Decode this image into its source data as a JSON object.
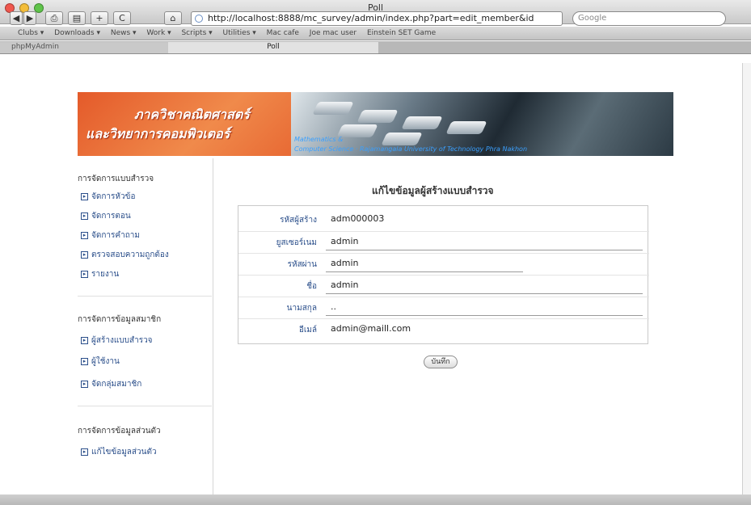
{
  "window": {
    "title": "Poll",
    "url": "http://localhost:8888/mc_survey/admin/index.php?part=edit_member&id",
    "search_placeholder": "Google",
    "nav": {
      "back": "◀",
      "forward": "▶",
      "print": "⎙",
      "readlater": "▤",
      "add": "+",
      "reload": "C",
      "home": "⌂"
    }
  },
  "bookmarks": [
    "Clubs ▾",
    "Downloads ▾",
    "News ▾",
    "Work ▾",
    "Scripts ▾",
    "Utilities ▾",
    "Mac cafe",
    "Joe mac user",
    "Einstein SET Game"
  ],
  "tabs": [
    {
      "label": "phpMyAdmin",
      "active": false
    },
    {
      "label": "Poll",
      "active": true
    }
  ],
  "banner": {
    "line1": "ภาควิชาคณิตศาสตร์",
    "line2": "และวิทยาการคอมพิวเตอร์",
    "caption1": "Mathematics &",
    "caption2": "Computer Science · Rajamangala University of Technology Phra Nakhon"
  },
  "sidebar": {
    "sections": [
      {
        "heading": "การจัดการแบบสำรวจ",
        "items": [
          "จัดการหัวข้อ",
          "จัดการตอน",
          "จัดการคำถาม",
          "ตรวจสอบความถูกต้อง",
          "รายงาน"
        ]
      },
      {
        "heading": "การจัดการข้อมูลสมาชิก",
        "items": [
          "ผู้สร้างแบบสำรวจ",
          "ผู้ใช้งาน",
          "จัดกลุ่มสมาชิก"
        ]
      },
      {
        "heading": "การจัดการข้อมูลส่วนตัว",
        "items": [
          "แก้ไขข้อมูลส่วนตัว"
        ]
      }
    ]
  },
  "form": {
    "title": "แก้ไขข้อมูลผู้สร้างแบบสำรวจ",
    "fields": [
      {
        "label": "รหัสผู้สร้าง",
        "value": "adm000003"
      },
      {
        "label": "ยูสเซอร์เนม",
        "value": "admin"
      },
      {
        "label": "รหัสผ่าน",
        "value": "admin"
      },
      {
        "label": "ชื่อ",
        "value": "admin"
      },
      {
        "label": "นามสกุล",
        "value": ".."
      },
      {
        "label": "อีเมล์",
        "value": "admin@maill.com"
      }
    ],
    "save_label": "บันทึก"
  },
  "colors": {
    "accent": "#e86a34",
    "link": "#2a4e8a"
  }
}
